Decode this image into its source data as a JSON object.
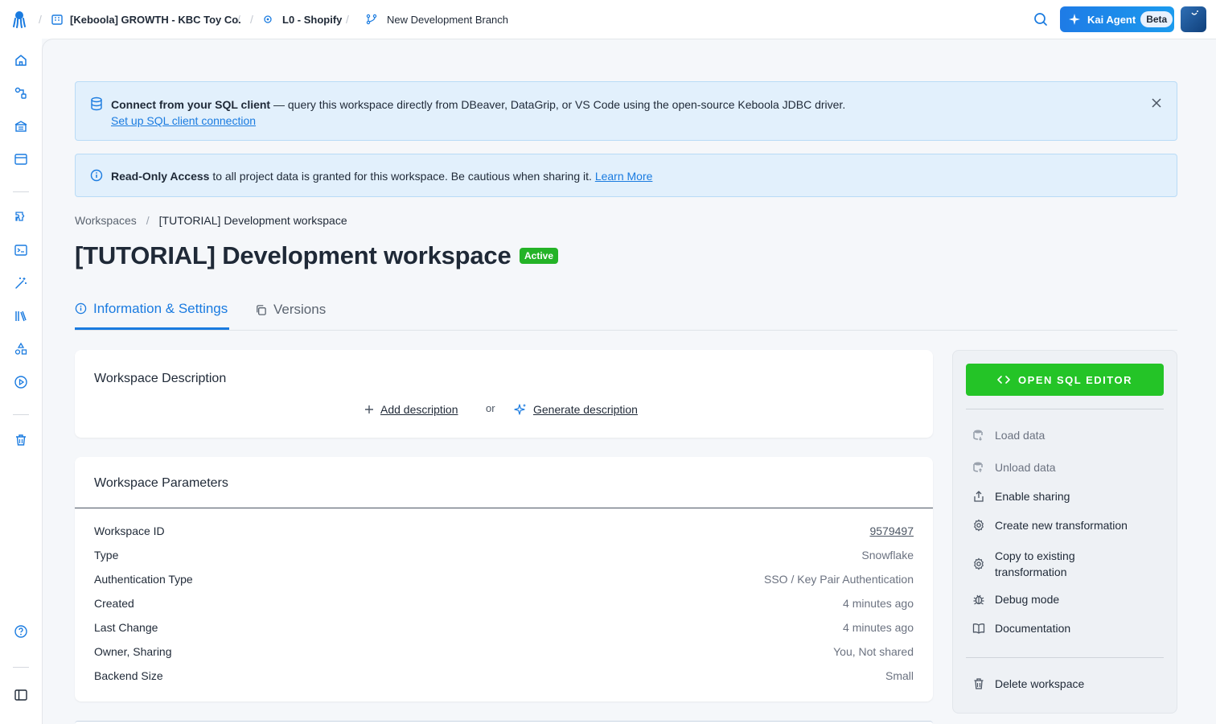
{
  "topbar": {
    "project": "[Keboola] GROWTH - KBC Toy Co.",
    "folder": "L0 - Shopify",
    "branch": "New Development Branch",
    "kai_label": "Kai Agent",
    "kai_badge": "Beta"
  },
  "banners": {
    "sql": {
      "strong": "Connect from your SQL client",
      "text": " — query this workspace directly from DBeaver, DataGrip, or VS Code using the open-source Keboola JDBC driver.",
      "link": "Set up SQL client connection"
    },
    "readonly": {
      "strong": "Read-Only Access",
      "text": " to all project data is granted for this workspace. Be cautious when sharing it. ",
      "link": "Learn More"
    }
  },
  "breadcrumb": {
    "parent": "Workspaces",
    "sep": "/",
    "current": "[TUTORIAL] Development workspace"
  },
  "page": {
    "title": "[TUTORIAL] Development workspace",
    "status": "Active"
  },
  "tabs": [
    {
      "label": "Information & Settings"
    },
    {
      "label": "Versions"
    }
  ],
  "description": {
    "title": "Workspace Description",
    "add": "Add description",
    "or": "or",
    "generate": "Generate description"
  },
  "parameters": {
    "title": "Workspace Parameters",
    "rows": [
      {
        "key": "Workspace ID",
        "value": "9579497"
      },
      {
        "key": "Type",
        "value": "Snowflake"
      },
      {
        "key": "Authentication Type",
        "value": "SSO / Key Pair Authentication"
      },
      {
        "key": "Created",
        "value": "4 minutes ago"
      },
      {
        "key": "Last Change",
        "value": "4 minutes ago"
      },
      {
        "key": "Owner, Sharing",
        "value": "You, Not shared"
      },
      {
        "key": "Backend Size",
        "value": "Small"
      }
    ]
  },
  "actions": {
    "open_sql": "OPEN SQL EDITOR",
    "load": "Load data",
    "unload": "Unload data",
    "share": "Enable sharing",
    "create": "Create new transformation",
    "copy_1": "Copy to existing",
    "copy_2": "transformation",
    "debug": "Debug mode",
    "docs": "Documentation",
    "delete": "Delete workspace"
  },
  "colors": {
    "accent": "#1a7be0",
    "success": "#24c427",
    "banner_bg": "#e2f0fc"
  }
}
